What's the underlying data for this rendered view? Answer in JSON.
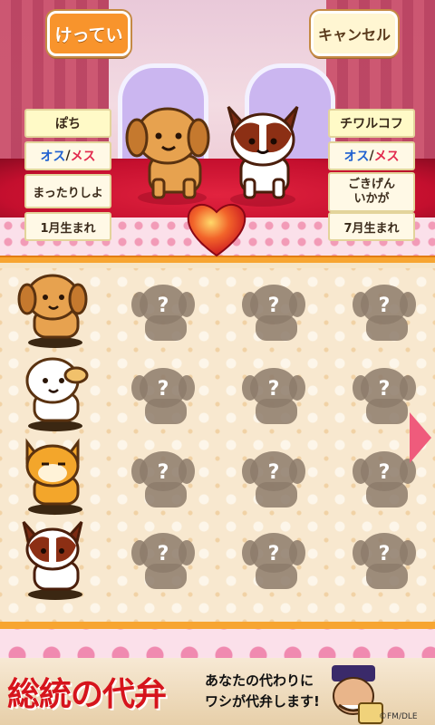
{
  "header": {
    "confirm_label": "けってい",
    "cancel_label": "キャンセル"
  },
  "left_pet": {
    "name": "ぽち",
    "sex_male": "オス",
    "sex_sep": "/",
    "sex_female": "メス",
    "mood": "まったりしよ",
    "birth": "1月生まれ"
  },
  "right_pet": {
    "name": "チワルコフ",
    "sex_male": "オス",
    "sex_sep": "/",
    "sex_female": "メス",
    "mood_line1": "ごきげん",
    "mood_line2": "いかが",
    "birth": "7月生まれ"
  },
  "grid": {
    "unknown_mark": "?",
    "rows": [
      {
        "owned": "brown-dog",
        "unknown": 3
      },
      {
        "owned": "white-dog",
        "unknown": 3
      },
      {
        "owned": "shiba-dog",
        "unknown": 3
      },
      {
        "owned": "chihuahua-dog",
        "unknown": 3
      }
    ]
  },
  "ad": {
    "title": "総統の代弁",
    "line1": "あなたの代わりに",
    "line2": "ワシが代弁します!",
    "copyright": "©FM/DLE"
  },
  "colors": {
    "accent_orange": "#f8942c",
    "heart_red": "#e3233e",
    "male_blue": "#1f60d0",
    "female_red": "#e22a4e",
    "arrow_pink": "#ef5b7c"
  }
}
